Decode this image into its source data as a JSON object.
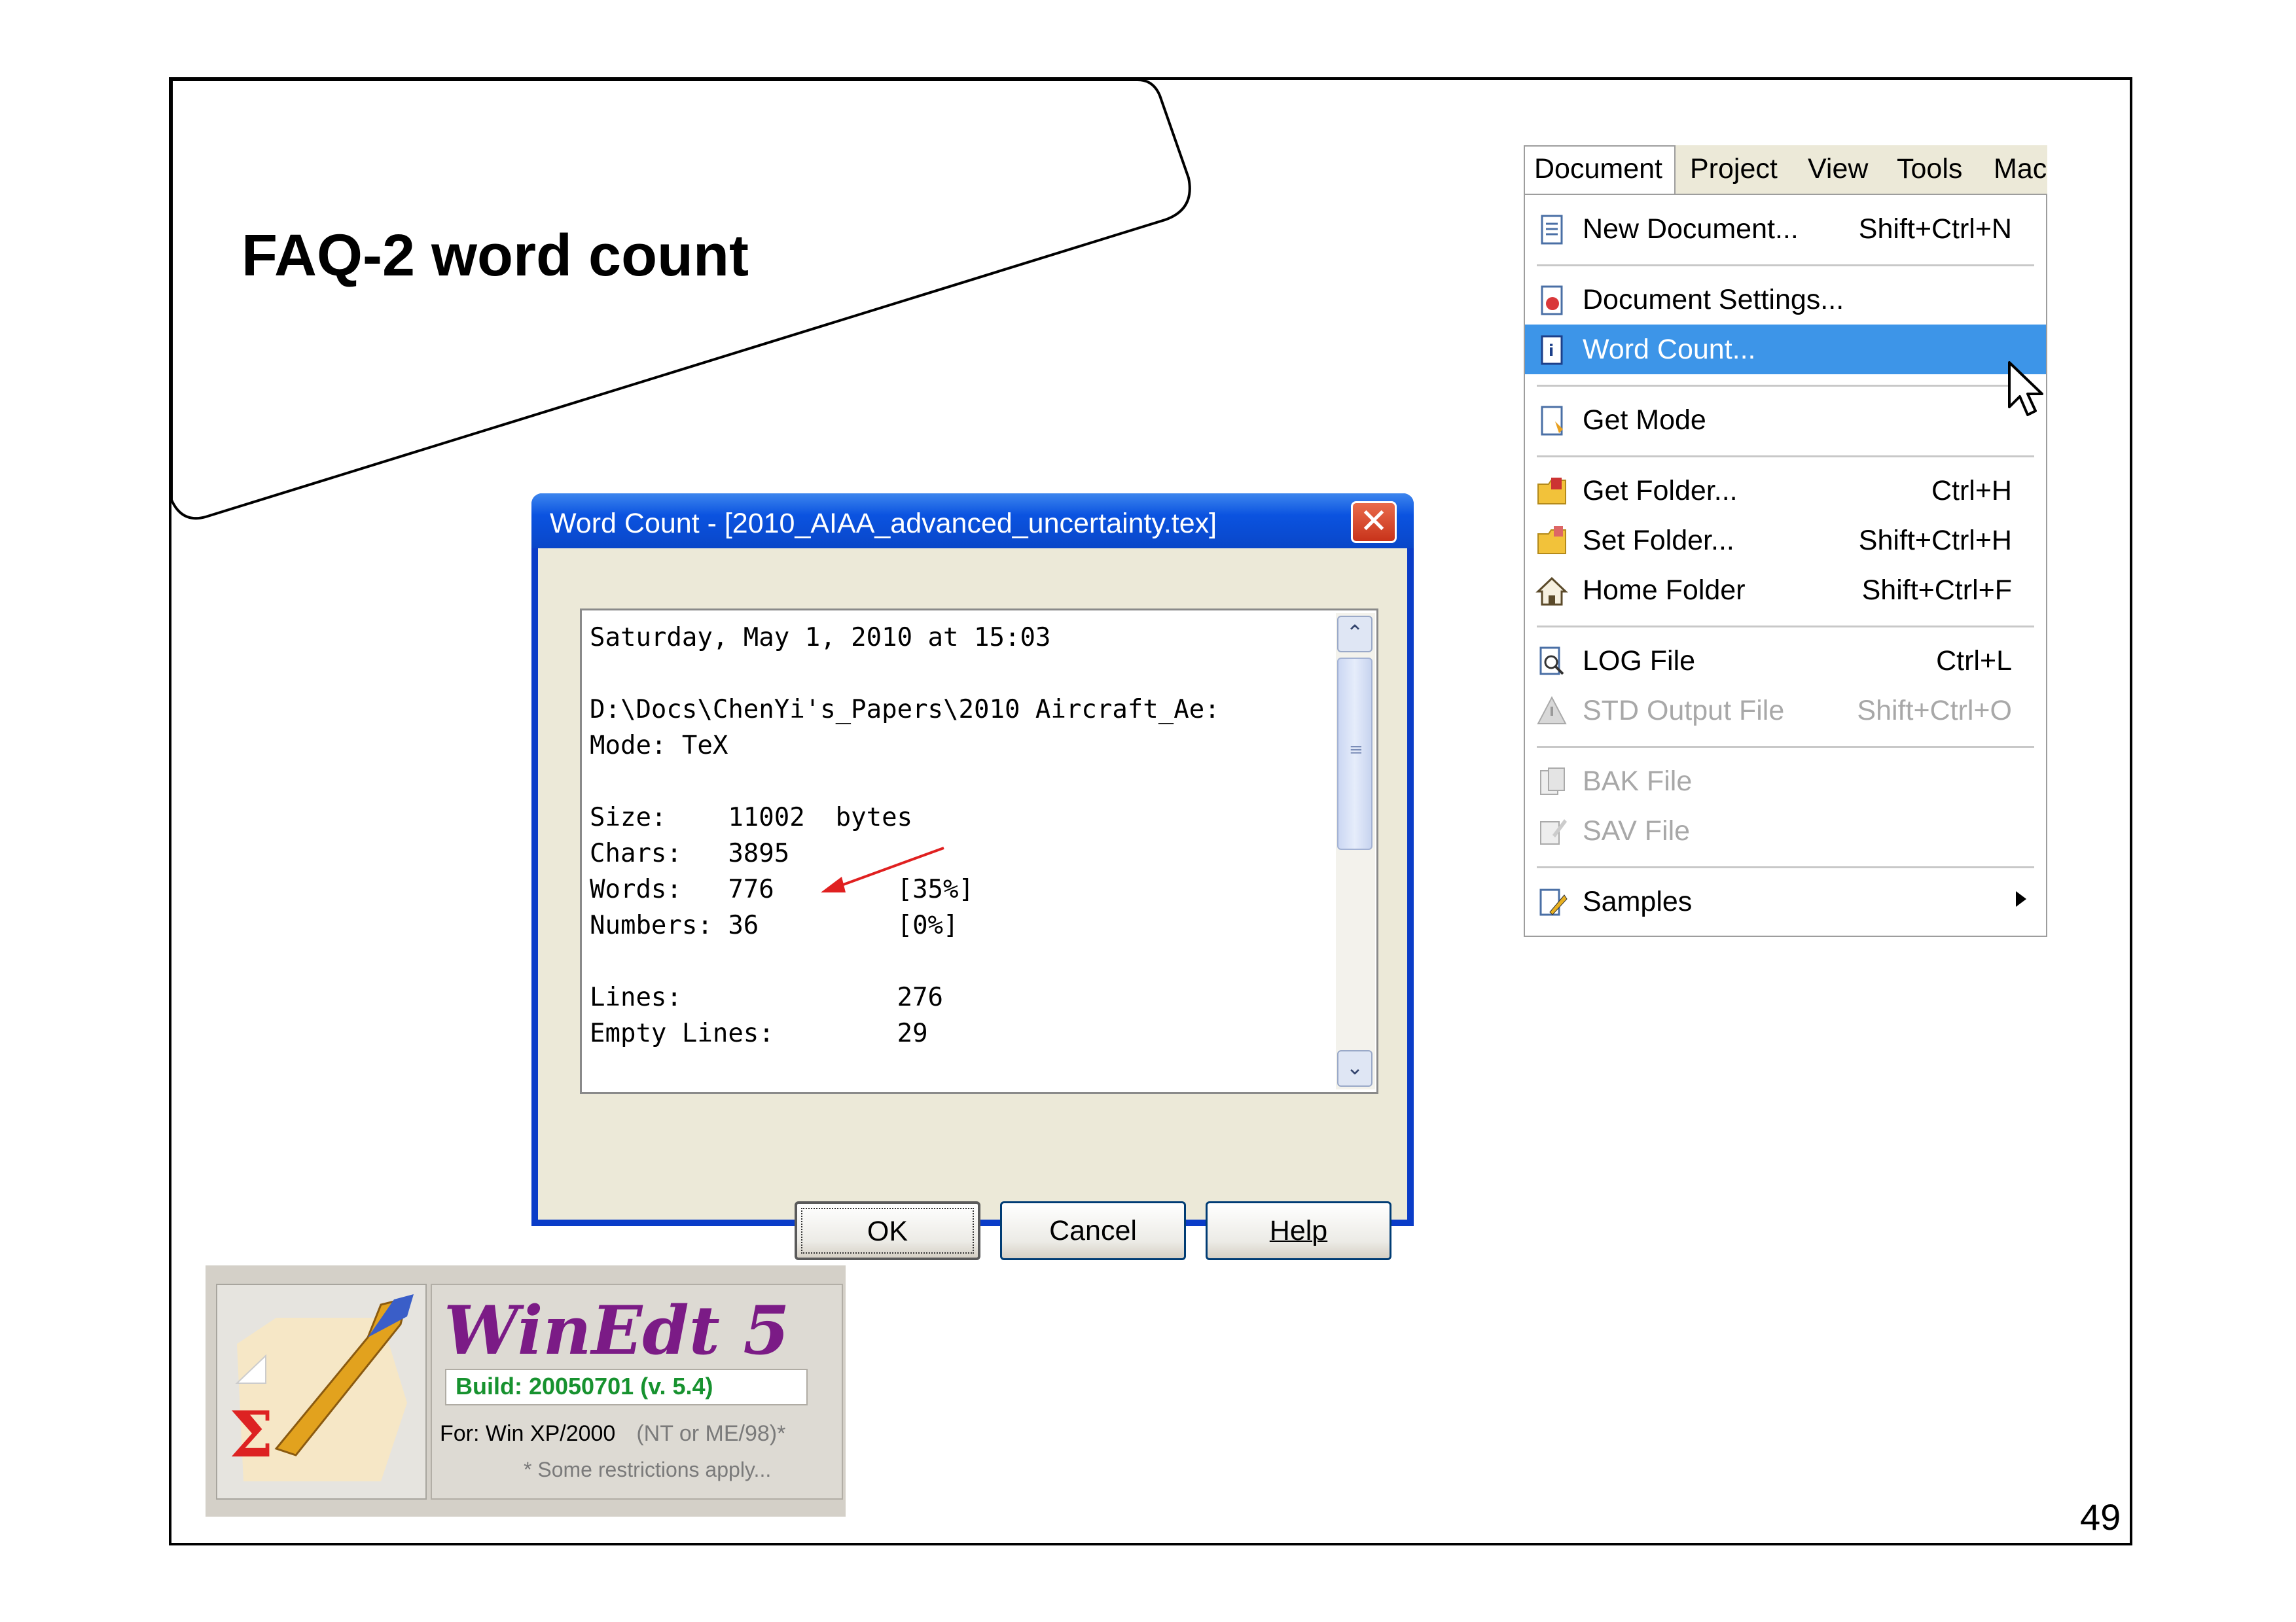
{
  "slide": {
    "title": "FAQ-2 word count",
    "page_number": "49"
  },
  "dialog": {
    "title": "Word Count - [2010_AIAA_advanced_uncertainty.tex]",
    "report_lines": [
      "Saturday, May 1, 2010 at 15:03",
      "",
      "D:\\Docs\\ChenYi's_Papers\\2010 Aircraft_Ae:",
      "Mode: TeX",
      "",
      "Size:    11002  bytes",
      "Chars:   3895",
      "Words:   776        [35%]",
      "Numbers: 36         [0%]",
      "",
      "Lines:              276",
      "Empty Lines:        29"
    ],
    "buttons": {
      "ok": "OK",
      "cancel": "Cancel",
      "help": "Help"
    },
    "arrow_color": "#e02020"
  },
  "menubar": {
    "items": [
      "Document",
      "Project",
      "View",
      "Tools",
      "Mac"
    ]
  },
  "menu": {
    "items": [
      {
        "label": "New Document...",
        "shortcut": "Shift+Ctrl+N",
        "icon": "new-document-icon"
      },
      {
        "label": "Document Settings...",
        "shortcut": "",
        "icon": "document-settings-icon"
      },
      {
        "label": "Word Count...",
        "shortcut": "",
        "icon": "word-count-icon",
        "highlighted": true
      },
      {
        "label": "Get Mode",
        "shortcut": "",
        "icon": "get-mode-icon"
      },
      {
        "label": "Get Folder...",
        "shortcut": "Ctrl+H",
        "icon": "get-folder-icon"
      },
      {
        "label": "Set Folder...",
        "shortcut": "Shift+Ctrl+H",
        "icon": "set-folder-icon"
      },
      {
        "label": "Home Folder",
        "shortcut": "Shift+Ctrl+F",
        "icon": "home-folder-icon"
      },
      {
        "label": "LOG File",
        "shortcut": "Ctrl+L",
        "icon": "log-file-icon"
      },
      {
        "label": "STD Output File",
        "shortcut": "Shift+Ctrl+O",
        "icon": "std-output-icon",
        "disabled": true
      },
      {
        "label": "BAK File",
        "shortcut": "",
        "icon": "bak-file-icon",
        "disabled": true
      },
      {
        "label": "SAV File",
        "shortcut": "",
        "icon": "sav-file-icon",
        "disabled": true
      },
      {
        "label": "Samples",
        "shortcut": "",
        "icon": "samples-icon",
        "submenu": true
      }
    ],
    "highlight_color": "#3d95e8"
  },
  "winedt": {
    "name": "WinEdt 5",
    "build": "Build: 20050701  (v. 5.4)",
    "for_label": "For:  Win  XP/2000",
    "for_note": "(NT or ME/98)*",
    "restrictions": "* Some restrictions  apply...",
    "name_color": "#7b1b86",
    "build_color": "#17922f"
  }
}
